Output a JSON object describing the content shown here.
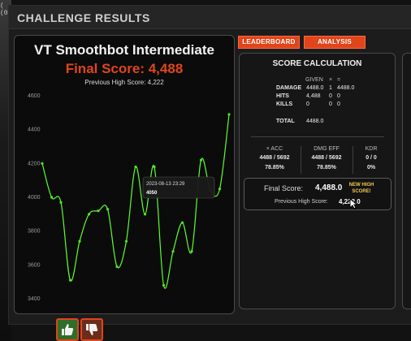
{
  "background": {
    "left_edge_text": "(\n(0"
  },
  "window": {
    "title": "CHALLENGE RESULTS"
  },
  "tabs": [
    {
      "label": "LEADERBOARD"
    },
    {
      "label": "ANALYSIS"
    }
  ],
  "results": {
    "scenario_name": "VT Smoothbot Intermediate",
    "final_score_text": "Final Score: 4,488",
    "previous_high_text": "Previous High Score: 4,222"
  },
  "chart_data": {
    "type": "line",
    "title": "",
    "xlabel": "",
    "ylabel": "",
    "ylim": [
      3400,
      4600
    ],
    "y_ticks": [
      "4600",
      "4400",
      "4200",
      "4000",
      "3800",
      "3600",
      "3400"
    ],
    "y_tick_values": [
      4600,
      4400,
      4200,
      4000,
      3800,
      3600,
      3400
    ],
    "series": [
      {
        "values": [
          4200,
          4000,
          3970,
          3510,
          3740,
          3900,
          3920,
          3930,
          3590,
          3740,
          4180,
          3900,
          4180,
          3480,
          3680,
          3850,
          3680,
          4220,
          4040,
          4050,
          4490
        ]
      }
    ],
    "tooltip": {
      "date": "2023-08-13 23:29",
      "value": "4050"
    },
    "colors": {
      "line": "#5dff2e",
      "point": "#4ee81f"
    }
  },
  "score_calc": {
    "title": "SCORE CALCULATION",
    "columns": [
      "GIVEN",
      "×",
      "="
    ],
    "rows": [
      {
        "label": "DAMAGE",
        "given": "4488.0",
        "mult": "1",
        "result": "4488.0"
      },
      {
        "label": "HITS",
        "given": "4,488",
        "mult": "0",
        "result": "0"
      },
      {
        "label": "KILLS",
        "given": "0",
        "mult": "0",
        "result": "0"
      }
    ],
    "total": {
      "label": "TOTAL",
      "value": "4488.0"
    },
    "stats": [
      {
        "header": "× ACC",
        "ratio": "4488 / 5692",
        "percent": "78.85%"
      },
      {
        "header": "DMG EFF",
        "ratio": "4488 / 5692",
        "percent": "78.85%"
      },
      {
        "header": "KDR",
        "ratio": "0 / 0",
        "percent": "0%"
      }
    ],
    "final_label": "Final Score:",
    "final_value": "4,488.0",
    "badge": "NEW HIGH SCORE!",
    "prev_label": "Previous High Score:",
    "prev_value": "4,222.0"
  },
  "feedback": {
    "thumbs_up": "thumbs-up",
    "thumbs_down": "thumbs-down"
  },
  "colors": {
    "accent": "#e0451b",
    "badge": "#f2c94c"
  }
}
